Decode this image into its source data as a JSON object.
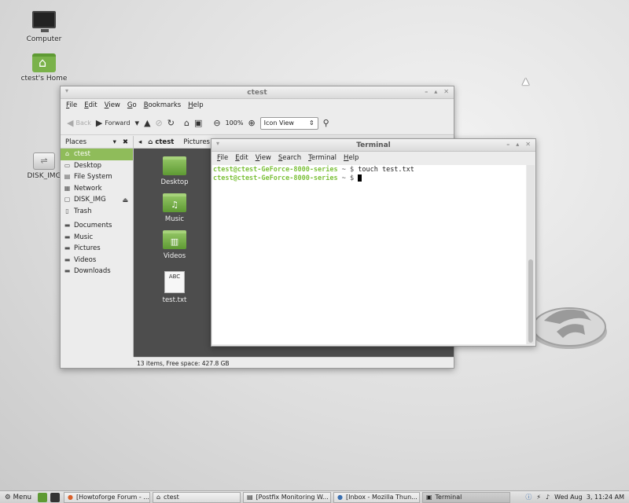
{
  "desktop": {
    "icons": [
      {
        "label": "Computer",
        "icon": "computer-icon"
      },
      {
        "label": "ctest's Home",
        "icon": "home-folder-icon"
      },
      {
        "label": "DISK_IMG",
        "icon": "usb-drive-icon"
      }
    ]
  },
  "file_manager": {
    "title": "ctest",
    "menu": [
      "File",
      "Edit",
      "View",
      "Go",
      "Bookmarks",
      "Help"
    ],
    "toolbar": {
      "back_label": "Back",
      "forward_label": "Forward",
      "zoom_level": "100%",
      "view_mode": "Icon View"
    },
    "sidebar": {
      "header": "Places",
      "items": [
        {
          "label": "ctest",
          "icon": "home-icon",
          "selected": true
        },
        {
          "label": "Desktop",
          "icon": "desktop-icon"
        },
        {
          "label": "File System",
          "icon": "drive-icon"
        },
        {
          "label": "Network",
          "icon": "network-icon"
        },
        {
          "label": "DISK_IMG",
          "icon": "drive-icon",
          "ejectable": true
        },
        {
          "label": "Trash",
          "icon": "trash-icon"
        },
        {
          "label": "Documents",
          "icon": "folder-icon"
        },
        {
          "label": "Music",
          "icon": "folder-icon"
        },
        {
          "label": "Pictures",
          "icon": "folder-icon"
        },
        {
          "label": "Videos",
          "icon": "folder-icon"
        },
        {
          "label": "Downloads",
          "icon": "folder-icon"
        }
      ]
    },
    "pathbar": {
      "current": "ctest",
      "next": "Pictures"
    },
    "files": [
      {
        "label": "Desktop",
        "kind": "folder"
      },
      {
        "label": "Music",
        "kind": "music-folder"
      },
      {
        "label": "Videos",
        "kind": "video-folder"
      },
      {
        "label": "test.txt",
        "kind": "text-file",
        "preview": "ABC"
      }
    ],
    "status": "13 items, Free space: 427.8 GB"
  },
  "terminal": {
    "title": "Terminal",
    "menu": [
      "File",
      "Edit",
      "View",
      "Search",
      "Terminal",
      "Help"
    ],
    "lines": [
      {
        "prompt": "ctest@ctest-GeForce-8000-series",
        "symbol": "~ $",
        "command": "touch test.txt"
      },
      {
        "prompt": "ctest@ctest-GeForce-8000-series",
        "symbol": "~ $",
        "command": ""
      }
    ]
  },
  "panel": {
    "menu_label": "Menu",
    "tasks": [
      {
        "label": "[Howtoforge Forum - ...",
        "icon": "firefox-icon"
      },
      {
        "label": "ctest",
        "icon": "home-icon"
      },
      {
        "label": "[Postfix Monitoring W...",
        "icon": "document-icon"
      },
      {
        "label": "[Inbox - Mozilla Thun...",
        "icon": "thunderbird-icon"
      },
      {
        "label": "Terminal",
        "icon": "terminal-icon",
        "active": true
      }
    ],
    "clock": "Wed Aug  3, 11:24 AM"
  },
  "colors": {
    "accent": "#8fbc5a",
    "prompt": "#7cc13a",
    "content_bg": "#4d4d4d"
  }
}
